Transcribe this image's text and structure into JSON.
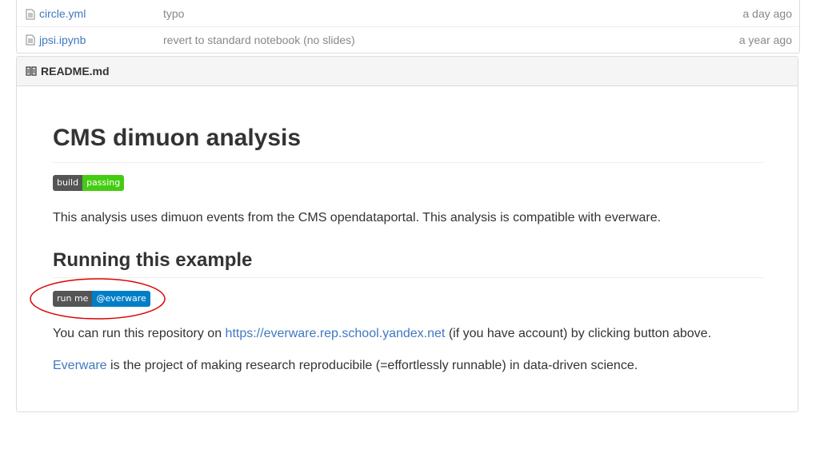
{
  "files": [
    {
      "name": "circle.yml",
      "message": "typo",
      "age": "a day ago"
    },
    {
      "name": "jpsi.ipynb",
      "message": "revert to standard notebook (no slides)",
      "age": "a year ago"
    }
  ],
  "readme": {
    "filename": "README.md",
    "title": "CMS dimuon analysis",
    "build_badge": {
      "left": "build",
      "right": "passing"
    },
    "intro": "This analysis uses dimuon events from the CMS opendataportal. This analysis is compatible with everware.",
    "section_title": "Running this example",
    "runme_badge": {
      "left": "run me",
      "right": "@everware"
    },
    "run_text_before": "You can run this repository on ",
    "run_link": "https://everware.rep.school.yandex.net",
    "run_text_after": " (if you have account) by clicking button above.",
    "everware_link": "Everware",
    "everware_text": " is the project of making research reproducibile (=effortlessly runnable) in data-driven science."
  },
  "colors": {
    "link": "#4078c0",
    "badge_left": "#555555",
    "badge_passing": "#44cc11",
    "badge_everware": "#007ec6",
    "annotation_circle": "#dd0000"
  }
}
